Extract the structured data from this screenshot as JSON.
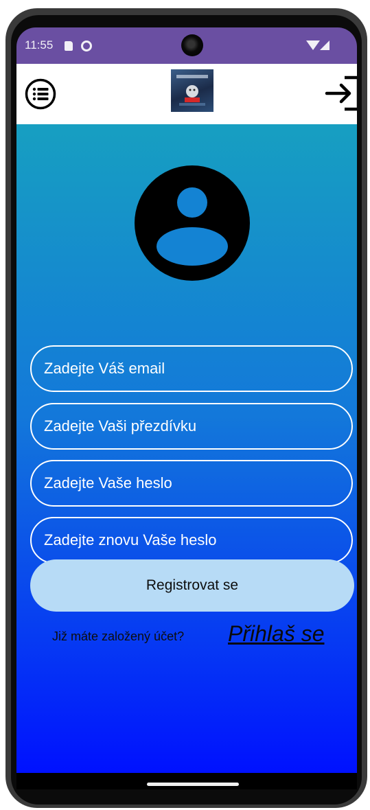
{
  "status_bar": {
    "time": "11:55",
    "icons": [
      "sd-card-icon",
      "sync-icon",
      "front-camera",
      "wifi-icon",
      "signal-icon"
    ]
  },
  "app_bar": {
    "menu_icon": "list-menu-icon",
    "logo": "app-logo",
    "login_icon": "login-arrow-icon"
  },
  "profile": {
    "icon": "account-circle-icon"
  },
  "form": {
    "email_placeholder": "Zadejte Váš email",
    "nickname_placeholder": "Zadejte Vaši přezdívku",
    "password_placeholder": "Zadejte Vaše heslo",
    "password_repeat_placeholder": "Zadejte znovu Vaše heslo",
    "register_label": "Registrovat se"
  },
  "signin": {
    "question": "Již máte založený účet?",
    "link_label": "Přihlaš se"
  },
  "colors": {
    "status_bar": "#6a4fa2",
    "gradient_top": "#179fc1",
    "gradient_bottom": "#0011ff",
    "button_fill": "#b7dbf6",
    "field_border": "#ffffff"
  }
}
